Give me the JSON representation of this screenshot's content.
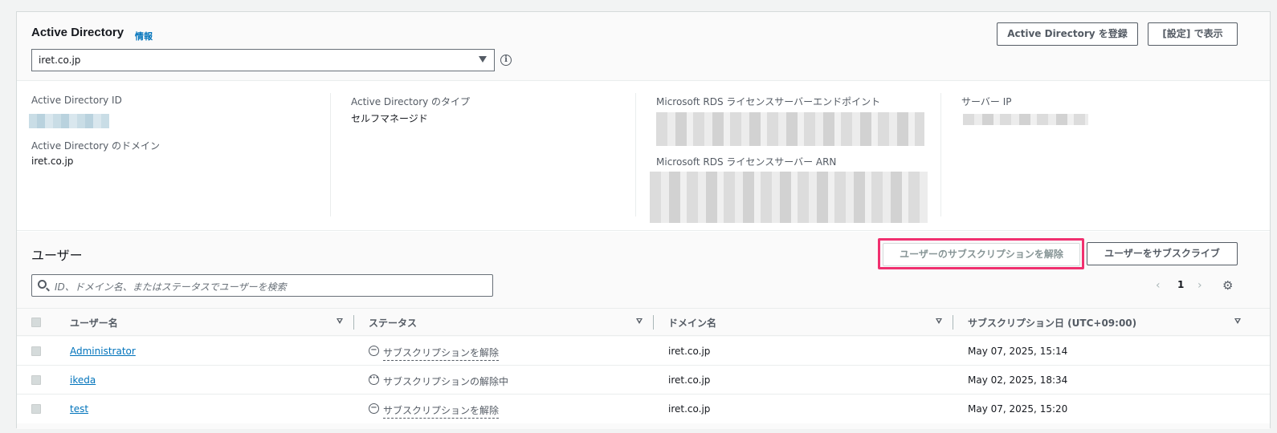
{
  "header": {
    "title": "Active Directory",
    "info_link": "情報",
    "directory_select_value": "iret.co.jp",
    "register_button": "Active Directory を登録",
    "settings_button": "[設定] で表示"
  },
  "details": {
    "ad_id_label": "Active Directory ID",
    "ad_domain_label": "Active Directory のドメイン",
    "ad_domain_value": "iret.co.jp",
    "ad_type_label": "Active Directory のタイプ",
    "ad_type_value": "セルフマネージド",
    "rds_endpoint_label": "Microsoft RDS ライセンスサーバーエンドポイント",
    "rds_arn_label": "Microsoft RDS ライセンスサーバー ARN",
    "server_ip_label": "サーバー IP"
  },
  "users": {
    "title": "ユーザー",
    "unsubscribe_button": "ユーザーのサブスクリプションを解除",
    "subscribe_button": "ユーザーをサブスクライブ",
    "search_placeholder": "ID、ドメイン名、またはステータスでユーザーを検索",
    "page": "1",
    "columns": [
      "ユーザー名",
      "ステータス",
      "ドメイン名",
      "サブスクリプション日 (UTC+09:00)"
    ],
    "rows": [
      {
        "username": "Administrator",
        "status": "サブスクリプションを解除",
        "status_icon": "minus-circle-icon",
        "domain": "iret.co.jp",
        "date": "May 07, 2025, 15:14"
      },
      {
        "username": "ikeda",
        "status": "サブスクリプションの解除中",
        "status_icon": "pending-circle-icon",
        "domain": "iret.co.jp",
        "date": "May 02, 2025, 18:34"
      },
      {
        "username": "test",
        "status": "サブスクリプションを解除",
        "status_icon": "minus-circle-icon",
        "domain": "iret.co.jp",
        "date": "May 07, 2025, 15:20"
      }
    ]
  },
  "colors": {
    "link": "#0073bb",
    "highlight": "#f0306f",
    "border": "#eaeded"
  }
}
